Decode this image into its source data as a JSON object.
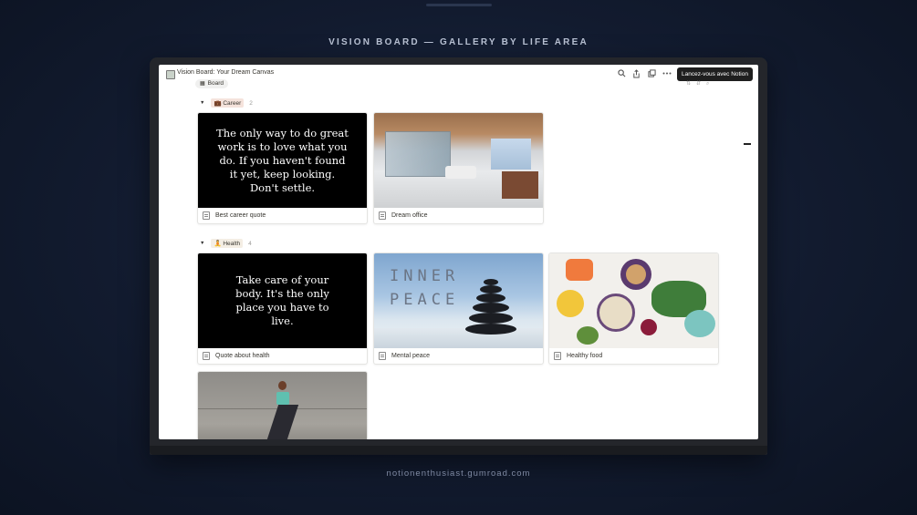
{
  "promo": {
    "title": "VISION BOARD — GALLERY BY LIFE AREA",
    "footer": "notionenthusiast.gumroad.com"
  },
  "app": {
    "breadcrumb": "Vision Board: Your Dream Canvas",
    "tooltip": "Lancez-vous avec Notion",
    "view_tab": "Board",
    "toolbar_icons": [
      "search-icon",
      "share-icon",
      "duplicate-icon",
      "more-icon"
    ]
  },
  "groups": [
    {
      "name": "Career",
      "emoji": "💼",
      "tag_color": "#f5e3dc",
      "count": "2",
      "cards": [
        {
          "title": "Best career quote",
          "cover_type": "quote",
          "quote": "The only way to do great work is to love what you do. If you haven't found it yet, keep looking. Don't settle."
        },
        {
          "title": "Dream office",
          "cover_type": "office-photo"
        }
      ]
    },
    {
      "name": "Health",
      "emoji": "🧘",
      "tag_color": "#f4eee4",
      "count": "4",
      "cards": [
        {
          "title": "Quote about health",
          "cover_type": "quote",
          "quote": "Take care of your body. It's the only place you have to live."
        },
        {
          "title": "Mental peace",
          "cover_type": "zen-stones-photo",
          "cover_text_1": "INNER",
          "cover_text_2": "PEACE"
        },
        {
          "title": "Healthy food",
          "cover_type": "food-photo"
        },
        {
          "title": "",
          "cover_type": "runner-photo"
        }
      ]
    }
  ]
}
